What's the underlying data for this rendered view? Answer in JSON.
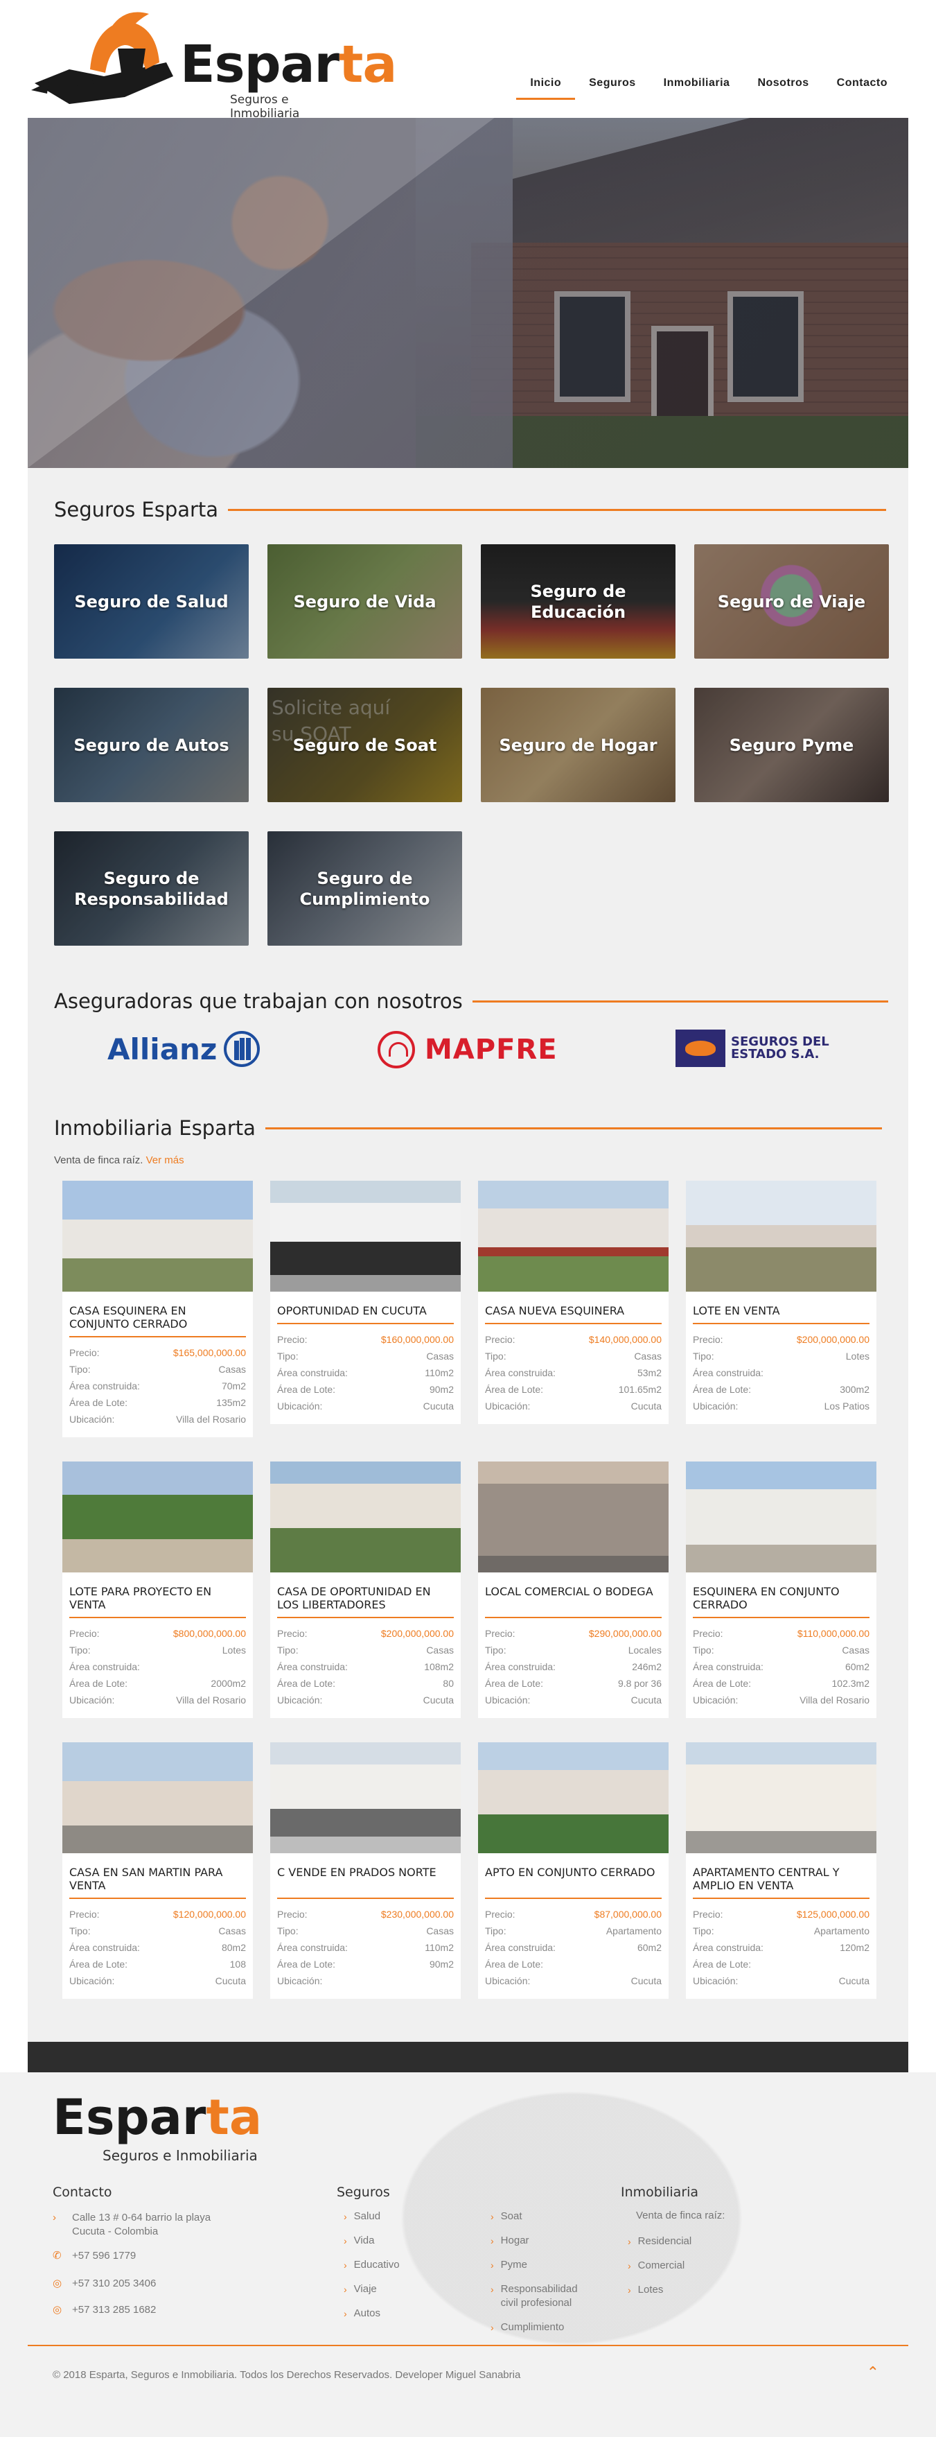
{
  "brand": {
    "name_dark": "Espar",
    "name_orange": "ta",
    "tagline": "Seguros e Inmobiliaria",
    "accent_color": "#ee7c21"
  },
  "nav": [
    {
      "label": "Inicio",
      "active": true
    },
    {
      "label": "Seguros",
      "active": false
    },
    {
      "label": "Inmobiliaria",
      "active": false
    },
    {
      "label": "Nosotros",
      "active": false
    },
    {
      "label": "Contacto",
      "active": false
    }
  ],
  "seguros": {
    "title": "Seguros Esparta",
    "tiles": [
      {
        "label": "Seguro de Salud"
      },
      {
        "label": "Seguro de Vida"
      },
      {
        "label": "Seguro de Educación"
      },
      {
        "label": "Seguro de Viaje"
      },
      {
        "label": "Seguro de Autos"
      },
      {
        "label": "Seguro de Soat",
        "bg_text": "Solicite aquí su SOAT"
      },
      {
        "label": "Seguro de Hogar"
      },
      {
        "label": "Seguro Pyme"
      },
      {
        "label": "Seguro de Responsabilidad"
      },
      {
        "label": "Seguro de Cumplimiento"
      }
    ]
  },
  "aseguradoras": {
    "title": "Aseguradoras que trabajan con nosotros",
    "logos": [
      {
        "name": "Allianz"
      },
      {
        "name": "MAPFRE"
      },
      {
        "name": "SEGUROS DEL ESTADO S.A."
      }
    ]
  },
  "inmobiliaria": {
    "title": "Inmobiliaria Esparta",
    "subtitle": "Venta de finca raíz.",
    "more_link": "Ver más",
    "labels": {
      "precio": "Precio:",
      "tipo": "Tipo:",
      "area_construida": "Área construida:",
      "area_lote": "Área de Lote:",
      "ubicacion": "Ubicación:"
    },
    "properties": [
      {
        "title": "CASA ESQUINERA EN CONJUNTO CERRADO",
        "precio": "$165,000,000.00",
        "tipo": "Casas",
        "area_construida": "70m2",
        "area_lote": "135m2",
        "ubicacion": "Villa del Rosario"
      },
      {
        "title": "OPORTUNIDAD EN CUCUTA",
        "precio": "$160,000,000.00",
        "tipo": "Casas",
        "area_construida": "110m2",
        "area_lote": "90m2",
        "ubicacion": "Cucuta"
      },
      {
        "title": "CASA NUEVA ESQUINERA",
        "precio": "$140,000,000.00",
        "tipo": "Casas",
        "area_construida": "53m2",
        "area_lote": "101.65m2",
        "ubicacion": "Cucuta"
      },
      {
        "title": "LOTE EN VENTA",
        "precio": "$200,000,000.00",
        "tipo": "Lotes",
        "area_construida": "",
        "area_lote": "300m2",
        "ubicacion": "Los Patios"
      },
      {
        "title": "LOTE PARA PROYECTO EN VENTA",
        "precio": "$800,000,000.00",
        "tipo": "Lotes",
        "area_construida": "",
        "area_lote": "2000m2",
        "ubicacion": "Villa del Rosario"
      },
      {
        "title": "CASA DE OPORTUNIDAD EN LOS LIBERTADORES",
        "precio": "$200,000,000.00",
        "tipo": "Casas",
        "area_construida": "108m2",
        "area_lote": "80",
        "ubicacion": "Cucuta"
      },
      {
        "title": "LOCAL COMERCIAL O BODEGA",
        "precio": "$290,000,000.00",
        "tipo": "Locales",
        "area_construida": "246m2",
        "area_lote": "9.8 por 36",
        "ubicacion": "Cucuta"
      },
      {
        "title": "ESQUINERA EN CONJUNTO CERRADO",
        "precio": "$110,000,000.00",
        "tipo": "Casas",
        "area_construida": "60m2",
        "area_lote": "102.3m2",
        "ubicacion": "Villa del Rosario"
      },
      {
        "title": "CASA EN SAN MARTIN PARA VENTA",
        "precio": "$120,000,000.00",
        "tipo": "Casas",
        "area_construida": "80m2",
        "area_lote": "108",
        "ubicacion": "Cucuta"
      },
      {
        "title": "C VENDE EN PRADOS NORTE",
        "precio": "$230,000,000.00",
        "tipo": "Casas",
        "area_construida": "110m2",
        "area_lote": "90m2",
        "ubicacion": ""
      },
      {
        "title": "APTO EN CONJUNTO CERRADO",
        "precio": "$87,000,000.00",
        "tipo": "Apartamento",
        "area_construida": "60m2",
        "area_lote": "",
        "ubicacion": "Cucuta"
      },
      {
        "title": "APARTAMENTO CENTRAL Y AMPLIO EN VENTA",
        "precio": "$125,000,000.00",
        "tipo": "Apartamento",
        "area_construida": "120m2",
        "area_lote": "",
        "ubicacion": "Cucuta"
      }
    ]
  },
  "footer": {
    "contact_title": "Contacto",
    "address": [
      "Calle 13 # 0-64 barrio la playa",
      "Cucuta - Colombia"
    ],
    "phones": [
      "+57 596 1779",
      "+57 310 205 3406",
      "+57 313 285 1682"
    ],
    "seguros_title": "Seguros",
    "seguros_col1": [
      "Salud",
      "Vida",
      "Educativo",
      "Viaje",
      "Autos"
    ],
    "seguros_col2": [
      "Soat",
      "Hogar",
      "Pyme",
      "Responsabilidad civil profesional",
      "Cumplimiento"
    ],
    "inmobiliaria_title": "Inmobiliaria",
    "inmobiliaria_intro": "Venta de finca raíz:",
    "inmobiliaria_items": [
      "Residencial",
      "Comercial",
      "Lotes"
    ],
    "copyright": "© 2018 Esparta, Seguros e Inmobiliaria. Todos los Derechos Reservados. Developer Miguel Sanabria"
  }
}
